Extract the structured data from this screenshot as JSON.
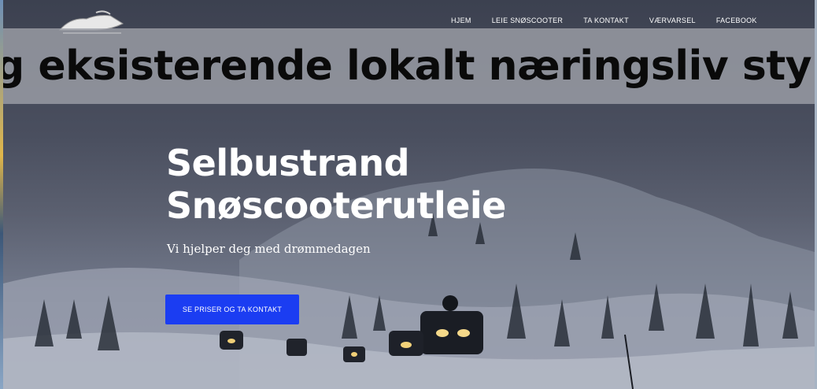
{
  "nav": {
    "items": [
      {
        "label": "HJEM"
      },
      {
        "label": "LEIE SNØSCOOTER"
      },
      {
        "label": "TA KONTAKT"
      },
      {
        "label": "VÆRVARSEL"
      },
      {
        "label": "FACEBOOK"
      }
    ]
  },
  "banner": {
    "text": "g eksisterende lokalt næringsliv styrkes"
  },
  "hero": {
    "title_line1": "Selbustrand",
    "title_line2": "Snøscooterutleie",
    "subtitle": "Vi hjelper deg med drømmedagen",
    "cta_label": "SE PRISER OG TA KONTAKT"
  },
  "colors": {
    "cta": "#1b3df2",
    "banner_bg": "#a0a3aa",
    "text_light": "#ffffff"
  },
  "icons": {
    "logo": "snowmobile-logo-icon"
  }
}
